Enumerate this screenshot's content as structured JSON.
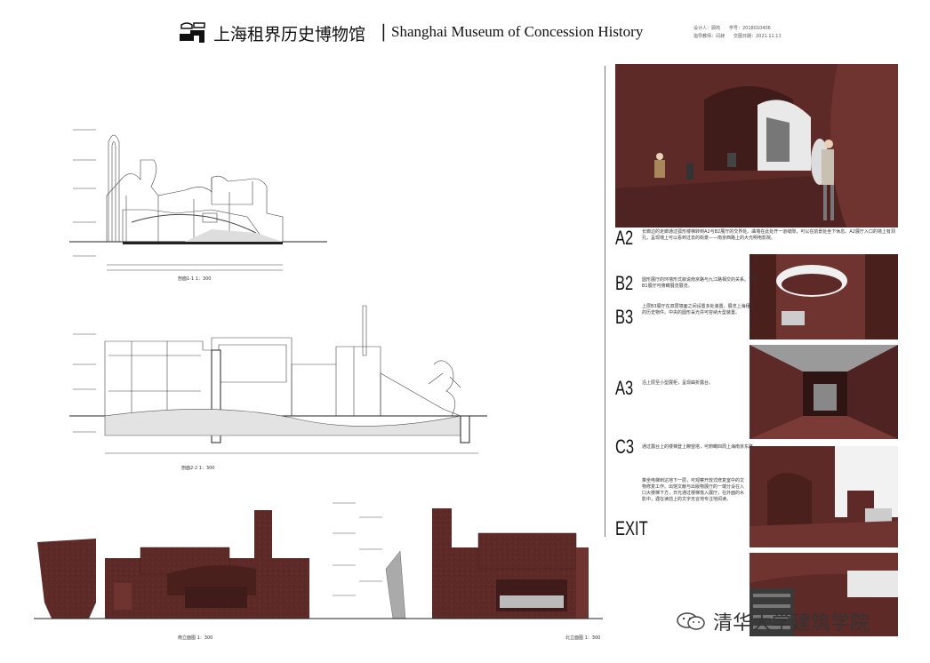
{
  "header": {
    "title_cn": "上海租界历史博物馆",
    "separator": "|",
    "title_en": "Shanghai Museum of Concession History",
    "meta_line1": "设计人：顾鸣　　学号：2018010406",
    "meta_line2": "指导教师：闫昶　　交图日期：2021.11.11"
  },
  "drawings": {
    "section1_caption": "剖面1-1 1：300",
    "section2_caption": "剖面2-2 1：300",
    "elevation_south_caption": "南立面图 1：300",
    "elevation_north_caption": "北立面图 1：300"
  },
  "sequence": [
    {
      "label": "A2",
      "note": "长廊边的走廊通过弧形楼梯转到A2与B2展厅的交界处。曲墙在此处开一道缝隙，可以在前景处坐下休息。A2展厅入口的墙上有洞孔，呈现墙上可以看到过去的街景——南京西路上的大光明电影院。"
    },
    {
      "label": "B2",
      "note": "圆形展厅的环墙形式叙说南京路与九江路相交的关系。下层B1展厅可俯瞰展览展览。"
    },
    {
      "label": "B3",
      "note": "上层B3展厅在双层墙面之间设置多处装置，展览上海租界的历史物件。中央的圆形采光井可容纳大型装置。"
    },
    {
      "label": "A3",
      "note": "沿上层至小型展柜，呈现曲折露台。"
    },
    {
      "label": "C3",
      "note": "通过露台上的楼梯登上瞭望塔，可俯瞰四周上海南京东路。"
    },
    {
      "label": "EXIT",
      "note": "乘坐电梯到达地下一层，可观察开放式修复室中的文物修复工作。出馆文献与出版物展厅的一端分设在入口大楼梯下方，日光通过楼梯落入展厅，在外面的水影中，遇在读前上的文字无言地专注地阅读。"
    }
  ],
  "watermark": {
    "text": "清华大学建筑学院",
    "icon": "wechat-icon"
  },
  "colors": {
    "brick": "#5e2a27",
    "brick_dark": "#3f1b19",
    "brick_light": "#7a3b36",
    "line": "#333333"
  }
}
